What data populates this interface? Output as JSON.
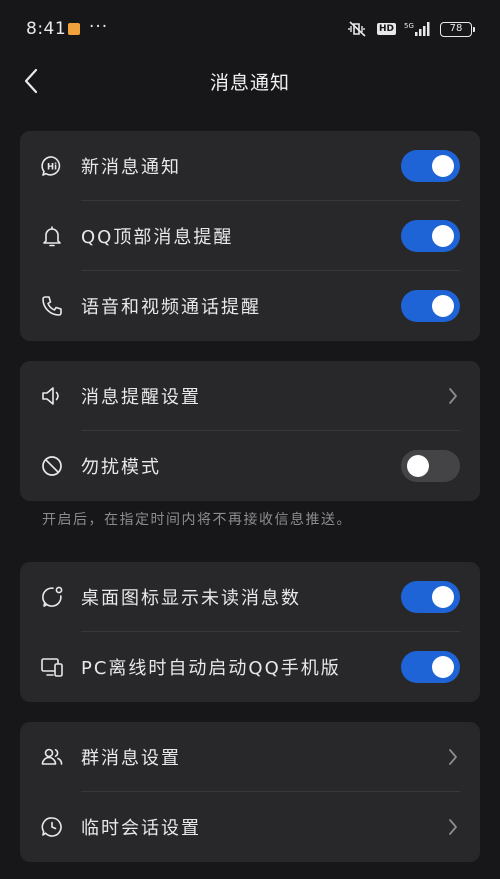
{
  "status_bar": {
    "time": "8:41",
    "more": "···",
    "hd": "HD",
    "network": "5G",
    "battery": "78"
  },
  "header": {
    "title": "消息通知",
    "back_icon": "chevron-left-icon"
  },
  "groups": [
    {
      "items": [
        {
          "icon": "hi-bubble-icon",
          "label": "新消息通知",
          "control": "toggle",
          "on": true
        },
        {
          "icon": "bell-icon",
          "label": "QQ顶部消息提醒",
          "control": "toggle",
          "on": true
        },
        {
          "icon": "phone-icon",
          "label": "语音和视频通话提醒",
          "control": "toggle",
          "on": true
        }
      ]
    },
    {
      "items": [
        {
          "icon": "speaker-icon",
          "label": "消息提醒设置",
          "control": "chevron"
        },
        {
          "icon": "no-disturb-icon",
          "label": "勿扰模式",
          "control": "toggle",
          "on": false
        }
      ],
      "hint": "开启后，在指定时间内将不再接收信息推送。"
    },
    {
      "items": [
        {
          "icon": "badge-bubble-icon",
          "label": "桌面图标显示未读消息数",
          "control": "toggle",
          "on": true
        },
        {
          "icon": "pc-phone-icon",
          "label": "PC离线时自动启动QQ手机版",
          "control": "toggle",
          "on": true
        }
      ]
    },
    {
      "items": [
        {
          "icon": "group-icon",
          "label": "群消息设置",
          "control": "chevron"
        },
        {
          "icon": "clock-icon",
          "label": "临时会话设置",
          "control": "chevron"
        }
      ]
    }
  ],
  "colors": {
    "background": "#171719",
    "card": "#28282b",
    "toggle_on": "#1e64d6",
    "toggle_off": "#444447"
  }
}
